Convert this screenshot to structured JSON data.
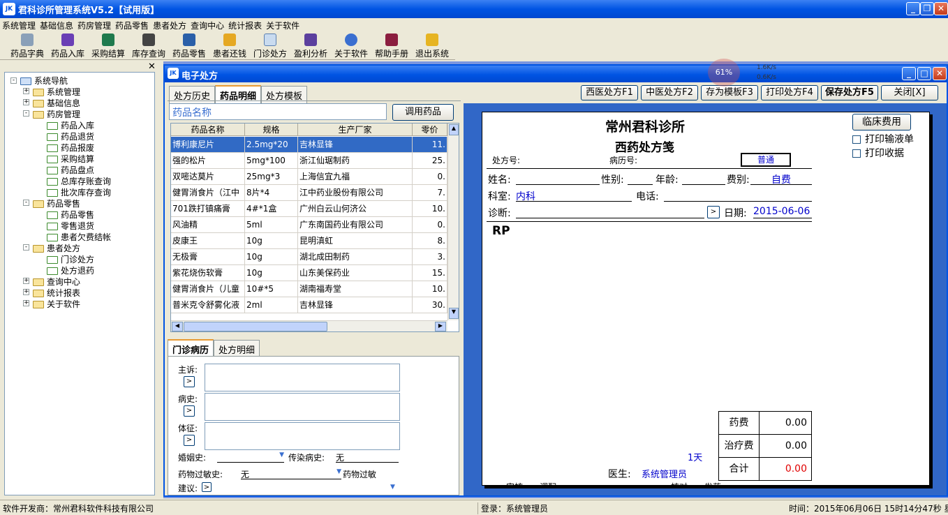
{
  "app": {
    "title": "君科诊所管理系统V5.2【试用版】",
    "icon": "app-logo-icon"
  },
  "menu": [
    "系统管理",
    "基础信息",
    "药房管理",
    "药品零售",
    "患者处方",
    "查询中心",
    "统计报表",
    "关于软件"
  ],
  "toolbar": [
    {
      "label": "药品字典",
      "icon": "syringe-icon"
    },
    {
      "label": "药品入库",
      "icon": "inbound-icon"
    },
    {
      "label": "采购结算",
      "icon": "ledger-icon"
    },
    {
      "label": "库存查询",
      "icon": "warehouse-icon"
    },
    {
      "label": "药品零售",
      "icon": "scale-icon"
    },
    {
      "label": "患者还钱",
      "icon": "coins-icon"
    },
    {
      "label": "门诊处方",
      "icon": "prescription-icon"
    },
    {
      "label": "盈利分析",
      "icon": "chart-icon"
    },
    {
      "label": "关于软件",
      "icon": "help-icon"
    },
    {
      "label": "帮助手册",
      "icon": "book-icon"
    },
    {
      "label": "退出系统",
      "icon": "exit-icon"
    }
  ],
  "nav": {
    "root": "系统导航",
    "items": [
      {
        "label": "系统管理",
        "level": 1,
        "expander": "+"
      },
      {
        "label": "基础信息",
        "level": 1,
        "expander": "+"
      },
      {
        "label": "药房管理",
        "level": 1,
        "expander": "-"
      },
      {
        "label": "药品入库",
        "level": 2
      },
      {
        "label": "药品退货",
        "level": 2
      },
      {
        "label": "药品报废",
        "level": 2
      },
      {
        "label": "采购结算",
        "level": 2
      },
      {
        "label": "药品盘点",
        "level": 2
      },
      {
        "label": "总库存账查询",
        "level": 2
      },
      {
        "label": "批次库存查询",
        "level": 2
      },
      {
        "label": "药品零售",
        "level": 1,
        "expander": "-"
      },
      {
        "label": "药品零售",
        "level": 2
      },
      {
        "label": "零售退货",
        "level": 2
      },
      {
        "label": "患者欠费结帐",
        "level": 2
      },
      {
        "label": "患者处方",
        "level": 1,
        "expander": "-"
      },
      {
        "label": "门诊处方",
        "level": 2,
        "open": true
      },
      {
        "label": "处方退药",
        "level": 2
      },
      {
        "label": "查询中心",
        "level": 1,
        "expander": "+"
      },
      {
        "label": "统计报表",
        "level": 1,
        "expander": "+"
      },
      {
        "label": "关于软件",
        "level": 1,
        "expander": "+"
      }
    ]
  },
  "net": {
    "cpu": "61%",
    "up": "1.6K/s",
    "down": "0.6K/s"
  },
  "child": {
    "title": "电子处方",
    "tabs": [
      "处方历史",
      "药品明细",
      "处方模板"
    ],
    "active_tab": 1,
    "buttons": [
      "西医处方F1",
      "中医处方F2",
      "存为模板F3",
      "打印处方F4",
      "保存处方F5",
      "关闭[X]"
    ],
    "search": {
      "placeholder": "药品名称",
      "button": "调用药品"
    },
    "grid": {
      "headers": [
        "药品名称",
        "规格",
        "生产厂家",
        "零价"
      ],
      "rows": [
        [
          "博利康尼片",
          "2.5mg*20",
          "吉林显锋",
          "11."
        ],
        [
          "强的松片",
          "5mg*100",
          "浙江仙琚制药",
          "25."
        ],
        [
          "双嘧达莫片",
          "25mg*3",
          "上海信宜九福",
          "0."
        ],
        [
          "健胃消食片（江中",
          "8片*4",
          "江中药业股份有限公司",
          "7."
        ],
        [
          "701跌打镇痛膏",
          "4#*1盒",
          "广州白云山何济公",
          "10."
        ],
        [
          "风油精",
          "5ml",
          "广东南国药业有限公司",
          "0."
        ],
        [
          "皮康王",
          "10g",
          "昆明滇虹",
          "8."
        ],
        [
          "无极膏",
          "10g",
          "湖北成田制药",
          "3."
        ],
        [
          "紫花烧伤软膏",
          "10g",
          "山东美保药业",
          "15."
        ],
        [
          "健胃消食片（儿童",
          "10#*5",
          "湖南福寿堂",
          "10."
        ],
        [
          "普米克令舒雾化液",
          "2ml",
          "吉林显锋",
          "30."
        ]
      ]
    },
    "record_tabs": [
      "门诊病历",
      "处方明细"
    ],
    "record": {
      "chief": "主诉:",
      "history": "病史:",
      "exam": "体征:",
      "marriage": "婚姻史:",
      "infect": "传染病史:",
      "infect_val": "无",
      "allergy": "药物过敏史:",
      "allergy_val": "无",
      "allergy_drug": "药物过敏",
      "advice": "建议:"
    },
    "rx": {
      "clinic": "常州君科诊所",
      "title": "西药处方笺",
      "rxno": "处方号:",
      "recno": "病历号:",
      "type": "普通",
      "name": "姓名:",
      "sex": "性别:",
      "age": "年龄:",
      "fee_type": "费别:",
      "fee_val": "自费",
      "dept": "科室:",
      "dept_val": "内科",
      "phone": "电话:",
      "diag": "诊断:",
      "date_label": "日期:",
      "date": "2015-06-06",
      "rp": "RP",
      "days": "1天",
      "doctor": "医生:",
      "doctor_val": "系统管理员",
      "bottom1": "审核",
      "bottom2": "调配",
      "bottom3": "核对",
      "bottom4": "发药",
      "fees": [
        [
          "药费",
          "0.00"
        ],
        [
          "治疗费",
          "0.00"
        ],
        [
          "合计",
          "0.00"
        ]
      ]
    },
    "side": {
      "clinic_btn": "临床费用",
      "opt1": "打印输液单",
      "opt2": "打印收据"
    }
  },
  "status": {
    "vendor": "软件开发商：常州君科软件科技有限公司",
    "login": "登录：系统管理员",
    "time": "时间：2015年06月06日  15时14分47秒  星期六"
  },
  "colors": {
    "title_blue": "#0054e3",
    "accent_blue": "#3167c7",
    "selection": "#316ac5",
    "total_red": "#e00000",
    "value_blue": "#0000cc"
  }
}
